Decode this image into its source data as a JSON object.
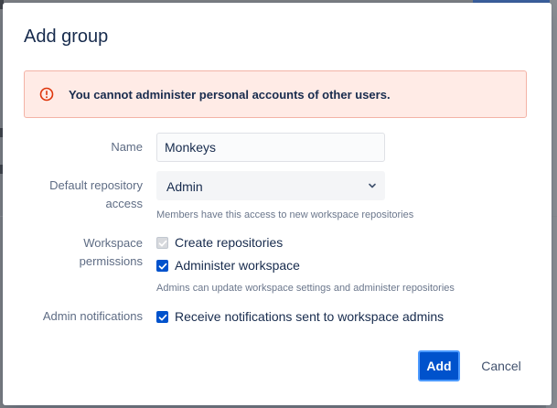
{
  "dialog": {
    "title": "Add group",
    "alert": {
      "icon": "error-icon",
      "message": "You cannot administer personal accounts of other users."
    },
    "fields": {
      "name": {
        "label": "Name",
        "value": "Monkeys"
      },
      "default_access": {
        "label_line1": "Default repository",
        "label_line2": "access",
        "selected": "Admin",
        "helper": "Members have this access to new workspace repositories"
      },
      "permissions": {
        "label_line1": "Workspace",
        "label_line2": "permissions",
        "options": [
          {
            "label": "Create repositories",
            "checked": true,
            "disabled": true
          },
          {
            "label": "Administer workspace",
            "checked": true,
            "disabled": false
          }
        ],
        "helper": "Admins can update workspace settings and administer repositories"
      },
      "notifications": {
        "label": "Admin notifications",
        "option": {
          "label": "Receive notifications sent to workspace admins",
          "checked": true
        }
      }
    },
    "buttons": {
      "add": "Add",
      "cancel": "Cancel"
    }
  },
  "colors": {
    "primary": "#0052cc",
    "alert_bg": "#ffebe6",
    "alert_icon": "#de350b"
  }
}
